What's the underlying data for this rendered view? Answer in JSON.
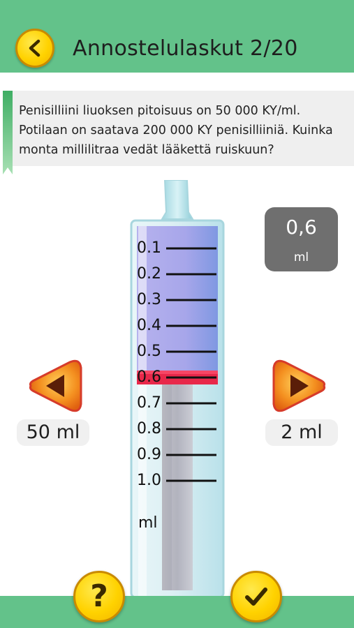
{
  "header": {
    "title": "Annostelulaskut 2/20",
    "back_icon": "chevron-left-icon",
    "background": "#63c28a"
  },
  "question": {
    "text": "Penisilliini liuoksen pitoisuus on 50 000 KY/ml. Potilaan on saatava 200 000 KY penisilliiniä. Kuinka monta millilitraa vedät lääkettä ruiskuun?"
  },
  "readout": {
    "value": "0,6",
    "unit": "ml"
  },
  "controls": {
    "decrease_icon": "triangle-left-icon",
    "increase_icon": "triangle-right-icon",
    "left_label": "50 ml",
    "right_label": "2 ml"
  },
  "syringe": {
    "scale_labels": [
      "0.1",
      "0.2",
      "0.3",
      "0.4",
      "0.5",
      "0.6",
      "0.7",
      "0.8",
      "0.9",
      "1.0"
    ],
    "unit": "ml",
    "selected_value": 0.6,
    "max_value": 1.0,
    "fill_color": "#a9a6e8",
    "plunger_color": "#e8284a"
  },
  "footer": {
    "help_label": "?",
    "check_icon": "checkmark-icon",
    "accent": "#ffd200"
  }
}
